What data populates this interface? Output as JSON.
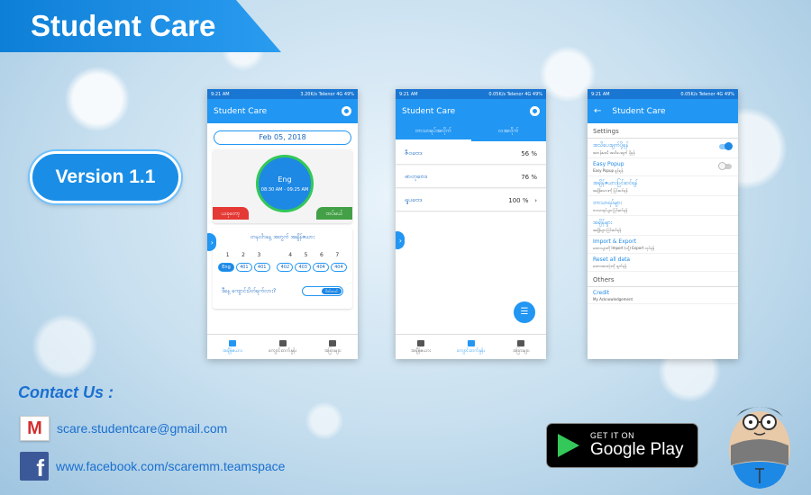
{
  "banner": {
    "title": "Student Care"
  },
  "version": {
    "label": "Version 1.1"
  },
  "phone1": {
    "status_left": "9:21 AM",
    "status_right": "3.20K/s  Telenor 4G  49%",
    "app_title": "Student Care",
    "date": "Feb 05, 2018",
    "current_subject": "Eng",
    "current_time": "08:30 AM - 09:25 AM",
    "tag_left": "ယခုတော့",
    "tag_right": "ထပ်မယ်",
    "periods_title": "တနင်္လာနေ့ အတွက် အချိန်ဇယား",
    "period_numbers": [
      "1",
      "2",
      "3",
      "4",
      "5",
      "6",
      "7"
    ],
    "period_chips": [
      "Eng",
      "401",
      "401",
      "402",
      "403",
      "404",
      "404"
    ],
    "question": "ဒီနေ့ ကျောင်းပိတ်ရက်လား?",
    "toggle_label": "ပိတ်တယ်",
    "nav": [
      "အချိန်ဇယား",
      "ကျောင်းတက်နှုန်း",
      "အခြားများ"
    ]
  },
  "phone2": {
    "status_left": "9:21 AM",
    "status_right": "0.05K/s  Telenor 4G  49%",
    "app_title": "Student Care",
    "tabs": [
      "ဘာသာရပ်အလိုက်",
      "လအလိုက်"
    ],
    "rows": [
      {
        "label": "ဇီဝဗေဒ",
        "value": "56 %"
      },
      {
        "label": "ဓာတုဗေဒ",
        "value": "76 %"
      },
      {
        "label": "ရူပဗေဒ",
        "value": "100 %"
      }
    ],
    "nav": [
      "အချိန်ဇယား",
      "ကျောင်းတက်နှုန်း",
      "အခြားများ"
    ]
  },
  "phone3": {
    "status_left": "9:21 AM",
    "status_right": "0.05K/s  Telenor 4G  49%",
    "app_title": "Student Care",
    "section_settings": "Settings",
    "items": [
      {
        "title": "အသိပေးချက်ပို့ရန်",
        "desc": "အတန်းမစမီ အသိပေးချက် ပို့ရန်"
      },
      {
        "title": "Easy Popup",
        "desc": "Easy Popup ဖွင့်ရန်"
      },
      {
        "title": "အချိန်ဇယားပြင်ဆင်ရန်",
        "desc": "အချိန်ဇယားကို ပြင်ဆင်ရန်"
      },
      {
        "title": "ဘာသာရပ်များ",
        "desc": "ဘာသာရပ်များ ပြင်ဆင်ရန်"
      },
      {
        "title": "အချိန်များ",
        "desc": "အချိန်များ ပြင်ဆင်ရန်"
      },
      {
        "title": "Import & Export",
        "desc": "ဒေတာများကို Import (သို့) Export လုပ်ရန်"
      },
      {
        "title": "Reset all data",
        "desc": "ဒေတာအားလုံးကို ဖျက်ရန်"
      }
    ],
    "section_others": "Others",
    "credit_title": "Credit",
    "credit_desc": "My Acknowledgement"
  },
  "contact": {
    "title": "Contact Us :",
    "email": "scare.studentcare@gmail.com",
    "facebook": "www.facebook.com/scaremm.teamspace"
  },
  "play_badge": {
    "small": "GET IT ON",
    "big": "Google Play"
  },
  "colors": {
    "primary": "#2196f3",
    "dark": "#1976d2",
    "accent_green": "#43a047",
    "accent_red": "#e53935"
  }
}
